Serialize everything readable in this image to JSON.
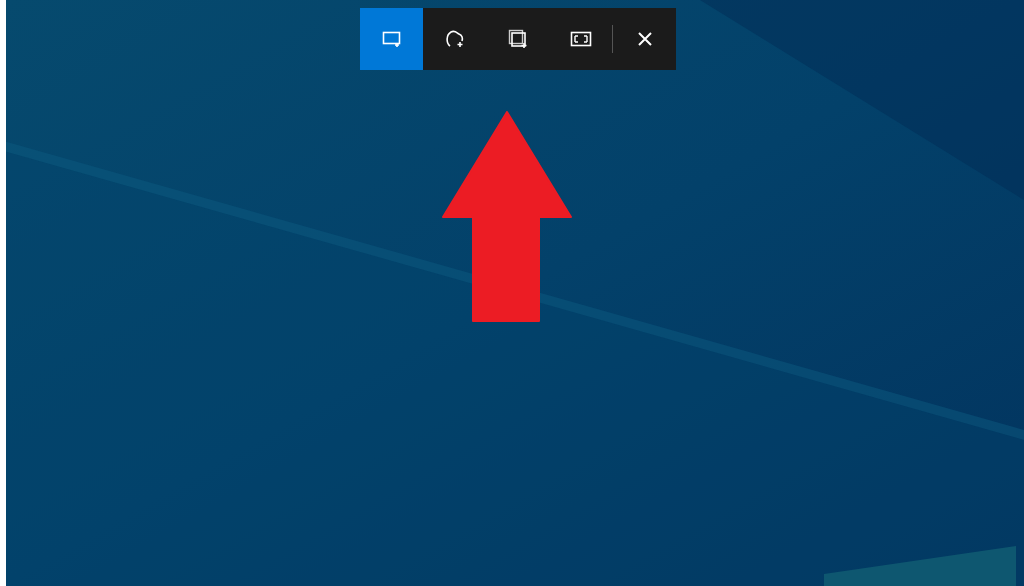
{
  "snip_toolbar": {
    "tools": [
      {
        "kind": "rectangle",
        "selected": true
      },
      {
        "kind": "freeform",
        "selected": false
      },
      {
        "kind": "window",
        "selected": false
      },
      {
        "kind": "fullscreen",
        "selected": false
      }
    ],
    "close": {
      "kind": "close"
    }
  },
  "annotation": {
    "kind": "arrow-up"
  }
}
